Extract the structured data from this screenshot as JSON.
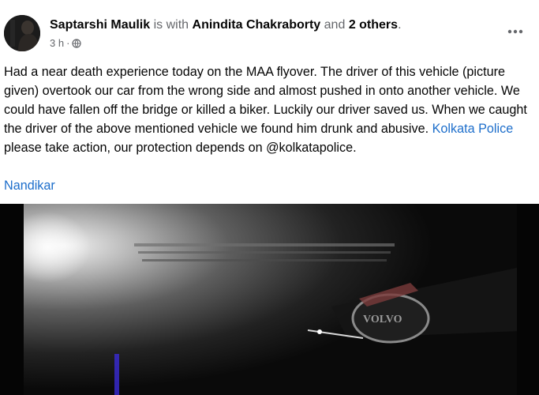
{
  "post": {
    "author": "Saptarshi Maulik",
    "with_text": "is with",
    "tagged_person": "Anindita Chakraborty",
    "and_text": "and",
    "others": "2 others",
    "period": ".",
    "timestamp": "3 h",
    "separator": "·",
    "privacy_icon": "globe-icon",
    "more_icon": "more-options-icon",
    "body_part1": "Had a near death experience today on the MAA flyover. The driver of this vehicle (picture given) overtook our car from the wrong side and almost pushed in onto another vehicle. We could have fallen off the bridge or killed a biker. Luckily our driver saved us. When we caught the driver of the above mentioned vehicle we found him drunk and abusive. ",
    "mention": "Kolkata Police",
    "body_part2": " please take action, our protection depends on @kolkatapolice.",
    "location": "Nandikar"
  },
  "photo": {
    "badge_text": "VOLVO",
    "description_icon": "vehicle-photo"
  },
  "colors": {
    "text": "#050505",
    "muted": "#65676b",
    "link": "#1d6ecb"
  }
}
